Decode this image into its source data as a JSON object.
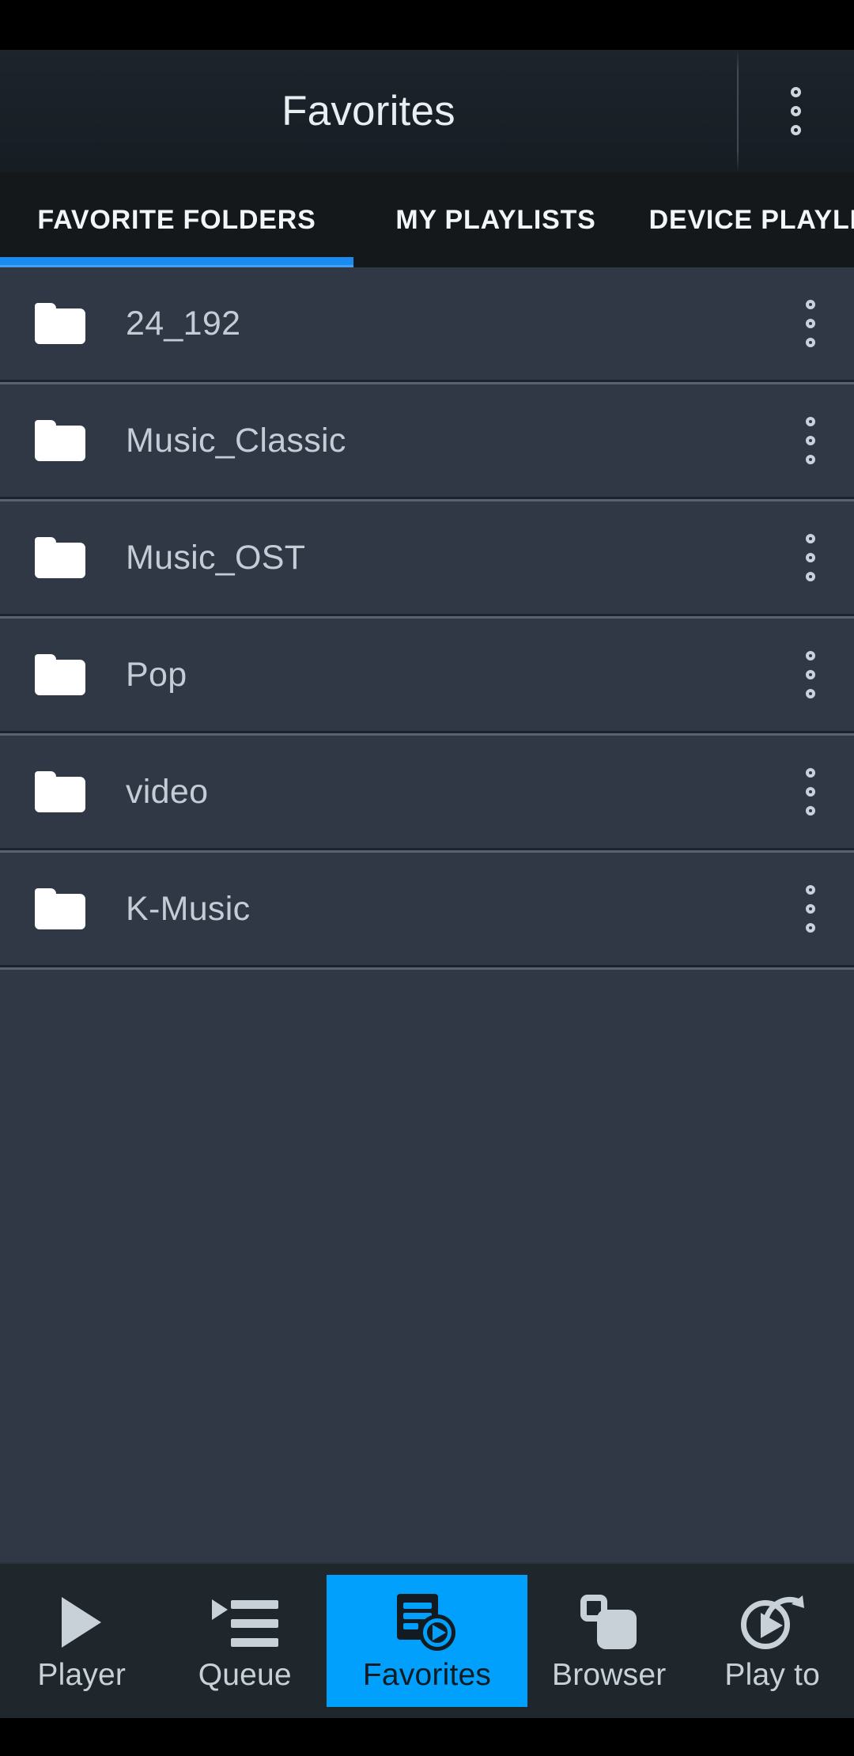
{
  "app": {
    "title": "Favorites",
    "accent_color": "#00a0fc",
    "tab_indicator_color": "#1a8bf0",
    "content_bg": "#303845",
    "appbar_bg": "#1a2128",
    "nav_bg": "#1f272d"
  },
  "app_bar": {
    "title": "Favorites",
    "overflow_icon": "more-vertical-icon"
  },
  "tabs": {
    "selected_index": 0,
    "items": [
      {
        "label": "FAVORITE FOLDERS"
      },
      {
        "label": "MY PLAYLISTS"
      },
      {
        "label": "DEVICE PLAYLISTS"
      }
    ]
  },
  "folder_list": {
    "item_icon": "folder-icon",
    "item_menu_icon": "more-vertical-icon",
    "items": [
      {
        "name": "24_192"
      },
      {
        "name": "Music_Classic"
      },
      {
        "name": "Music_OST"
      },
      {
        "name": "Pop"
      },
      {
        "name": "video"
      },
      {
        "name": "K-Music"
      }
    ]
  },
  "bottom_nav": {
    "selected_index": 2,
    "items": [
      {
        "label": "Player",
        "icon": "play-icon"
      },
      {
        "label": "Queue",
        "icon": "playlist-queue-icon"
      },
      {
        "label": "Favorites",
        "icon": "playlist-play-icon"
      },
      {
        "label": "Browser",
        "icon": "stacked-squares-icon"
      },
      {
        "label": "Play to",
        "icon": "cast-play-icon"
      }
    ]
  }
}
